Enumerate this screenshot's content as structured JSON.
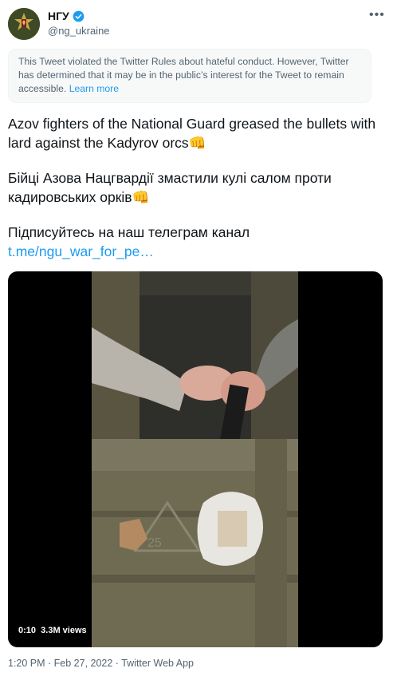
{
  "author": {
    "display_name": "НГУ",
    "handle": "@ng_ukraine",
    "verified_icon": "verified-badge-icon",
    "more_icon": "more-options-icon"
  },
  "notice": {
    "text": "This Tweet violated the Twitter Rules about hateful conduct. However, Twitter has determined that it may be in the public’s interest for the Tweet to remain accessible.",
    "link_label": "Learn more"
  },
  "tweet": {
    "paragraph_1": "Azov fighters of the National Guard greased the bullets with lard against the Kadyrov orcs",
    "paragraph_2": "Бійці Азова Нацгвардії змастили кулі салом проти кадировських орків",
    "paragraph_3": "Підписуйтесь на наш телеграм канал",
    "link": "t.me/ngu_war_for_pe…",
    "emoji": "👊"
  },
  "video": {
    "duration": "0:10",
    "views": "3.3M views",
    "crate_marking": "25"
  },
  "meta": {
    "timestamp": "1:20 PM · Feb 27, 2022 · Twitter Web App"
  },
  "colors": {
    "link": "#1d9bf0",
    "secondary_text": "#536471",
    "primary_text": "#0f1419"
  }
}
